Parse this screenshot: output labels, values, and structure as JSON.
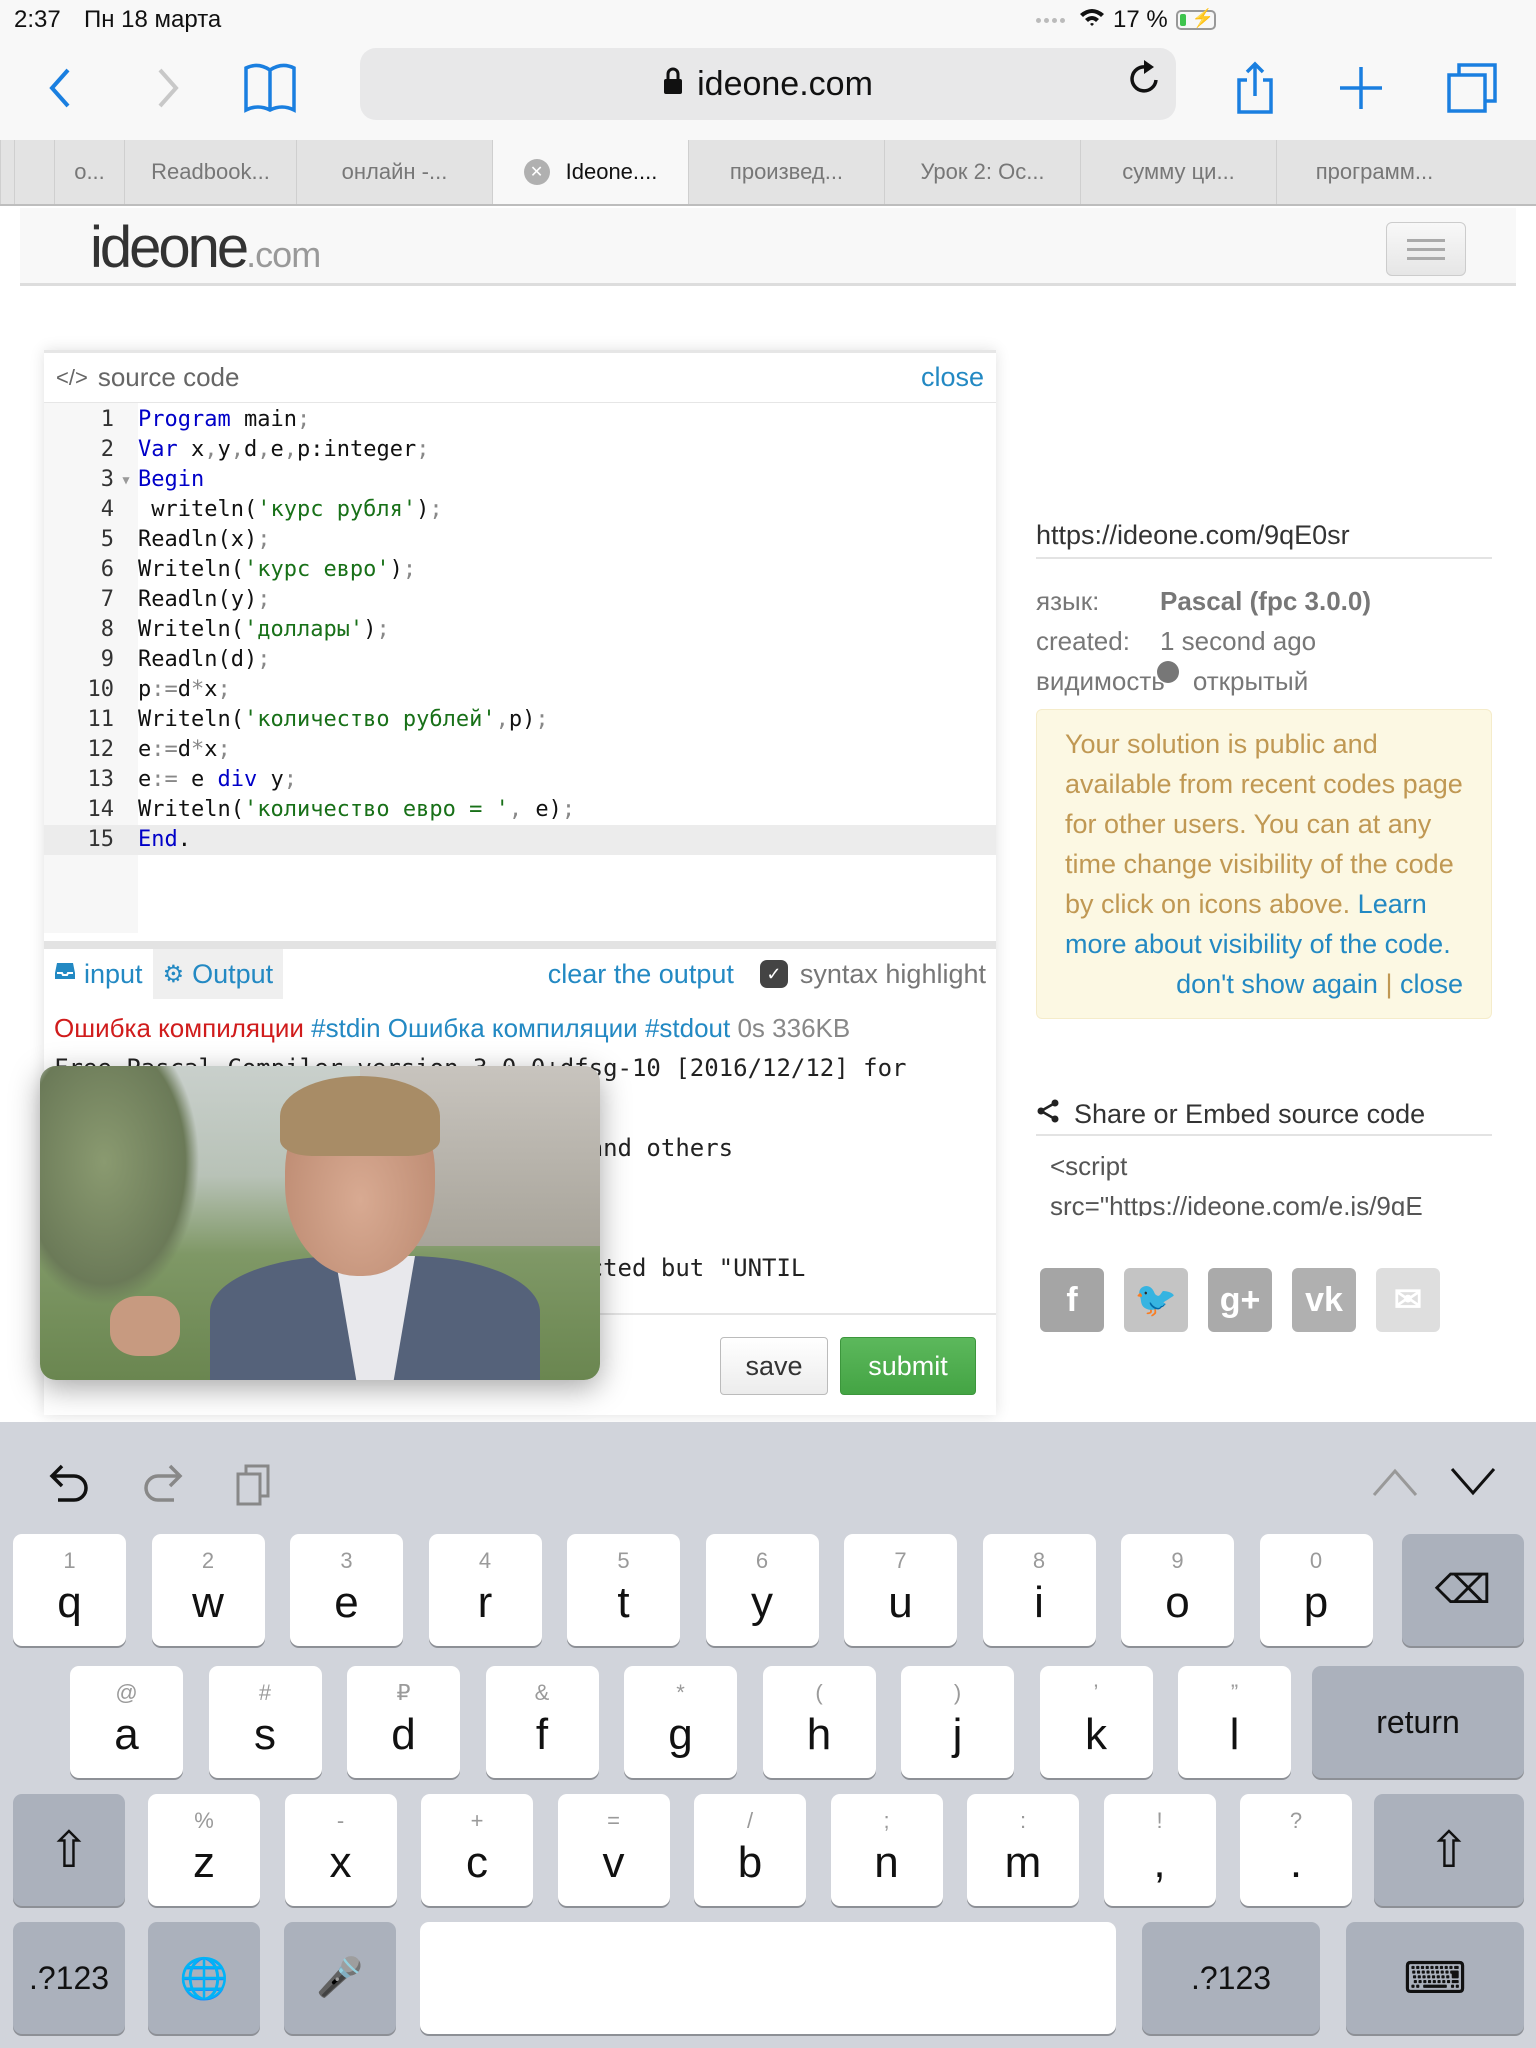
{
  "status_bar": {
    "time": "2:37",
    "date": "Пн 18 марта",
    "battery": "17 %",
    "battery_level_percent": 17,
    "charging": true
  },
  "browser": {
    "url": "ideone.com",
    "icons": [
      "back-icon",
      "forward-icon",
      "bookmarks-icon",
      "lock-icon",
      "reload-icon",
      "share-icon",
      "new-tab-icon",
      "tabs-icon"
    ],
    "tabs": [
      {
        "label": ""
      },
      {
        "label": ""
      },
      {
        "label": "о..."
      },
      {
        "label": "Readbook..."
      },
      {
        "label": "онлайн -..."
      },
      {
        "label": "Ideone....",
        "active": true
      },
      {
        "label": "произвед..."
      },
      {
        "label": "Урок 2: Ос..."
      },
      {
        "label": "сумму ци..."
      },
      {
        "label": "программ..."
      }
    ]
  },
  "site": {
    "logo_main": "ideone",
    "logo_suffix": ".com"
  },
  "editor": {
    "header_icon": "</>",
    "title": "source code",
    "close_label": "close",
    "active_line": 15,
    "lines": [
      [
        {
          "t": "kw",
          "v": "Program"
        },
        {
          "t": "",
          "v": " main"
        },
        {
          "t": "op",
          "v": ";"
        }
      ],
      [
        {
          "t": "kw",
          "v": "Var"
        },
        {
          "t": "",
          "v": " x"
        },
        {
          "t": "op",
          "v": ","
        },
        {
          "t": "",
          "v": "y"
        },
        {
          "t": "op",
          "v": ","
        },
        {
          "t": "",
          "v": "d"
        },
        {
          "t": "op",
          "v": ","
        },
        {
          "t": "",
          "v": "e"
        },
        {
          "t": "op",
          "v": ","
        },
        {
          "t": "",
          "v": "p:integer"
        },
        {
          "t": "op",
          "v": ";"
        }
      ],
      [
        {
          "t": "kw",
          "v": "Begin"
        }
      ],
      [
        {
          "t": "",
          "v": " writeln("
        },
        {
          "t": "str",
          "v": "'курс рубля'"
        },
        {
          "t": "",
          "v": ")"
        },
        {
          "t": "op",
          "v": ";"
        }
      ],
      [
        {
          "t": "",
          "v": "Readln(x)"
        },
        {
          "t": "op",
          "v": ";"
        }
      ],
      [
        {
          "t": "",
          "v": "Writeln("
        },
        {
          "t": "str",
          "v": "'курс евро'"
        },
        {
          "t": "",
          "v": ")"
        },
        {
          "t": "op",
          "v": ";"
        }
      ],
      [
        {
          "t": "",
          "v": "Readln(y)"
        },
        {
          "t": "op",
          "v": ";"
        }
      ],
      [
        {
          "t": "",
          "v": "Writeln("
        },
        {
          "t": "str",
          "v": "'доллары'"
        },
        {
          "t": "",
          "v": ")"
        },
        {
          "t": "op",
          "v": ";"
        }
      ],
      [
        {
          "t": "",
          "v": "Readln(d)"
        },
        {
          "t": "op",
          "v": ";"
        }
      ],
      [
        {
          "t": "",
          "v": "p"
        },
        {
          "t": "op",
          "v": ":="
        },
        {
          "t": "",
          "v": "d"
        },
        {
          "t": "op",
          "v": "*"
        },
        {
          "t": "",
          "v": "x"
        },
        {
          "t": "op",
          "v": ";"
        }
      ],
      [
        {
          "t": "",
          "v": "Writeln("
        },
        {
          "t": "str",
          "v": "'количество рублей'"
        },
        {
          "t": "op",
          "v": ","
        },
        {
          "t": "",
          "v": "p)"
        },
        {
          "t": "op",
          "v": ";"
        }
      ],
      [
        {
          "t": "",
          "v": "e"
        },
        {
          "t": "op",
          "v": ":="
        },
        {
          "t": "",
          "v": "d"
        },
        {
          "t": "op",
          "v": "*"
        },
        {
          "t": "",
          "v": "x"
        },
        {
          "t": "op",
          "v": ";"
        }
      ],
      [
        {
          "t": "",
          "v": "e"
        },
        {
          "t": "op",
          "v": ":="
        },
        {
          "t": "",
          "v": " e "
        },
        {
          "t": "kw",
          "v": "div"
        },
        {
          "t": "",
          "v": " y"
        },
        {
          "t": "op",
          "v": ";"
        }
      ],
      [
        {
          "t": "",
          "v": "Writeln("
        },
        {
          "t": "str",
          "v": "'количество евро = '"
        },
        {
          "t": "op",
          "v": ","
        },
        {
          "t": "",
          "v": " e)"
        },
        {
          "t": "op",
          "v": ";"
        }
      ],
      [
        {
          "t": "kw",
          "v": "End"
        },
        {
          "t": "",
          "v": "."
        }
      ]
    ]
  },
  "io": {
    "input_label": "input",
    "output_label": "Output",
    "clear_label": "clear the output",
    "syntax_label": "syntax highlight",
    "syntax_checked": true
  },
  "output": {
    "status_error": "Ошибка компиляции",
    "stdin_tag": "#stdin",
    "status_error2": "Ошибка компиляции",
    "stdout_tag": "#stdout",
    "meta": "0s 336KB",
    "lines": [
      "Free Pascal Compiler version 3.0.0+dfsg-10 [2016/12/12] for",
      "",
      "                            Klaempfl and others",
      "",
      "",
      "                             \";\" expected but \"UNTIL"
    ]
  },
  "actions": {
    "save_label": "save",
    "submit_label": "submit"
  },
  "sidebar": {
    "url": "https://ideone.com/9qE0sr",
    "language_key": "язык:",
    "language_value": "Pascal (fpc 3.0.0)",
    "created_key": "created:",
    "created_value": "1 second ago",
    "visibility_key": "видимость",
    "visibility_value": "открытый",
    "alert_text": "Your solution is public and available from recent codes page for other users. You can at any time change visibility of the code by click on icons above.",
    "alert_link": "Learn more about visibility of the code.",
    "dont_show": "don't show again",
    "alert_sep": "|",
    "alert_close": "close",
    "share_title": "Share or Embed source code",
    "embed_code": "<script src=\"https://ideone.com/e.js/9qE",
    "socials": [
      {
        "name": "facebook",
        "glyph": "f",
        "color": "#a5a5a5"
      },
      {
        "name": "twitter",
        "glyph": "🐦",
        "color": "#c4c4c4"
      },
      {
        "name": "google-plus",
        "glyph": "g+",
        "color": "#aaaaaa"
      },
      {
        "name": "vk",
        "glyph": "vk",
        "color": "#b0b0b0"
      },
      {
        "name": "email",
        "glyph": "✉",
        "color": "#dedede"
      }
    ]
  },
  "keyboard": {
    "row1": [
      [
        "1",
        "q"
      ],
      [
        "2",
        "w"
      ],
      [
        "3",
        "e"
      ],
      [
        "4",
        "r"
      ],
      [
        "5",
        "t"
      ],
      [
        "6",
        "y"
      ],
      [
        "7",
        "u"
      ],
      [
        "8",
        "i"
      ],
      [
        "9",
        "o"
      ],
      [
        "0",
        "p"
      ]
    ],
    "row2": [
      [
        "@",
        "a"
      ],
      [
        "#",
        "s"
      ],
      [
        "₽",
        "d"
      ],
      [
        "&",
        "f"
      ],
      [
        "*",
        "g"
      ],
      [
        "(",
        "h"
      ],
      [
        ")",
        "j"
      ],
      [
        "’",
        "k"
      ],
      [
        "”",
        "l"
      ]
    ],
    "row3": [
      [
        "%",
        "z"
      ],
      [
        "-",
        "x"
      ],
      [
        "+",
        "c"
      ],
      [
        "=",
        "v"
      ],
      [
        "/",
        "b"
      ],
      [
        ";",
        "n"
      ],
      [
        ":",
        "m"
      ],
      [
        "!",
        ","
      ],
      [
        "?",
        "."
      ]
    ],
    "return_label": "return",
    "numbers_label": ".?123",
    "space_label": ""
  }
}
